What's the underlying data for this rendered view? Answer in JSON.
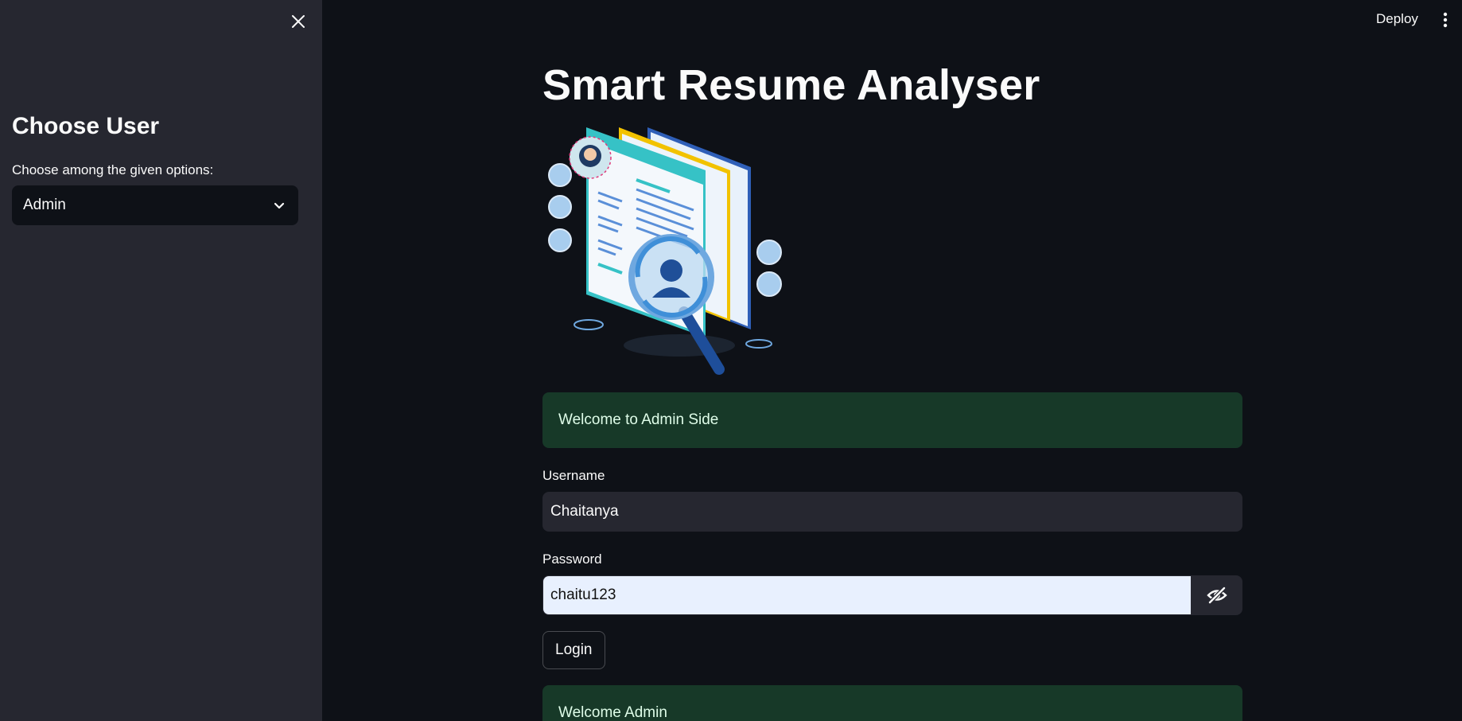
{
  "sidebar": {
    "title": "Choose User",
    "select_label": "Choose among the given options:",
    "select_value": "Admin"
  },
  "header": {
    "deploy_label": "Deploy"
  },
  "main": {
    "title": "Smart Resume Analyser",
    "welcome_side": "Welcome to Admin Side",
    "username_label": "Username",
    "username_value": "Chaitanya",
    "password_label": "Password",
    "password_value": "chaitu123",
    "login_label": "Login",
    "welcome_admin": "Welcome Admin"
  },
  "colors": {
    "background": "#0e1117",
    "sidebar": "#262730",
    "success_bg": "#173928",
    "success_text": "#dffde9",
    "autofill_bg": "#e8f0fe"
  },
  "icons": [
    "close-icon",
    "chevron-down-icon",
    "more-vertical-icon",
    "eye-off-icon"
  ]
}
